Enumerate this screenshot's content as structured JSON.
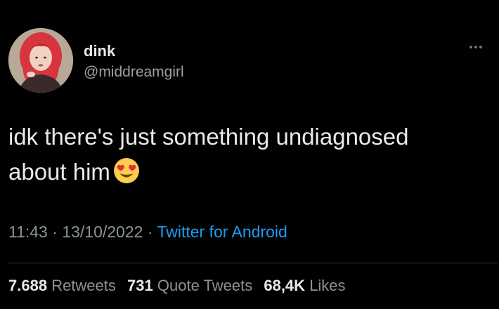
{
  "author": {
    "display_name": "dink",
    "handle": "@middreamgirl",
    "avatar_icon": "profile-photo-red-hair"
  },
  "menu_icon": "more-options-icon",
  "tweet": {
    "line1": "idk there's just something undiagnosed",
    "line2": "about him",
    "emoji": "heart-eyes-emoji"
  },
  "meta": {
    "time": "11:43",
    "sep1": " · ",
    "date": "13/10/2022",
    "sep2": " · ",
    "source": "Twitter for Android"
  },
  "stats": {
    "retweets_count": "7.688",
    "retweets_label": "Retweets",
    "quotes_count": "731",
    "quotes_label": "Quote Tweets",
    "likes_count": "68,4K",
    "likes_label": "Likes"
  },
  "colors": {
    "background": "#000000",
    "text": "#e7e9ea",
    "secondary": "#8b9399",
    "link": "#1d9bf0"
  }
}
